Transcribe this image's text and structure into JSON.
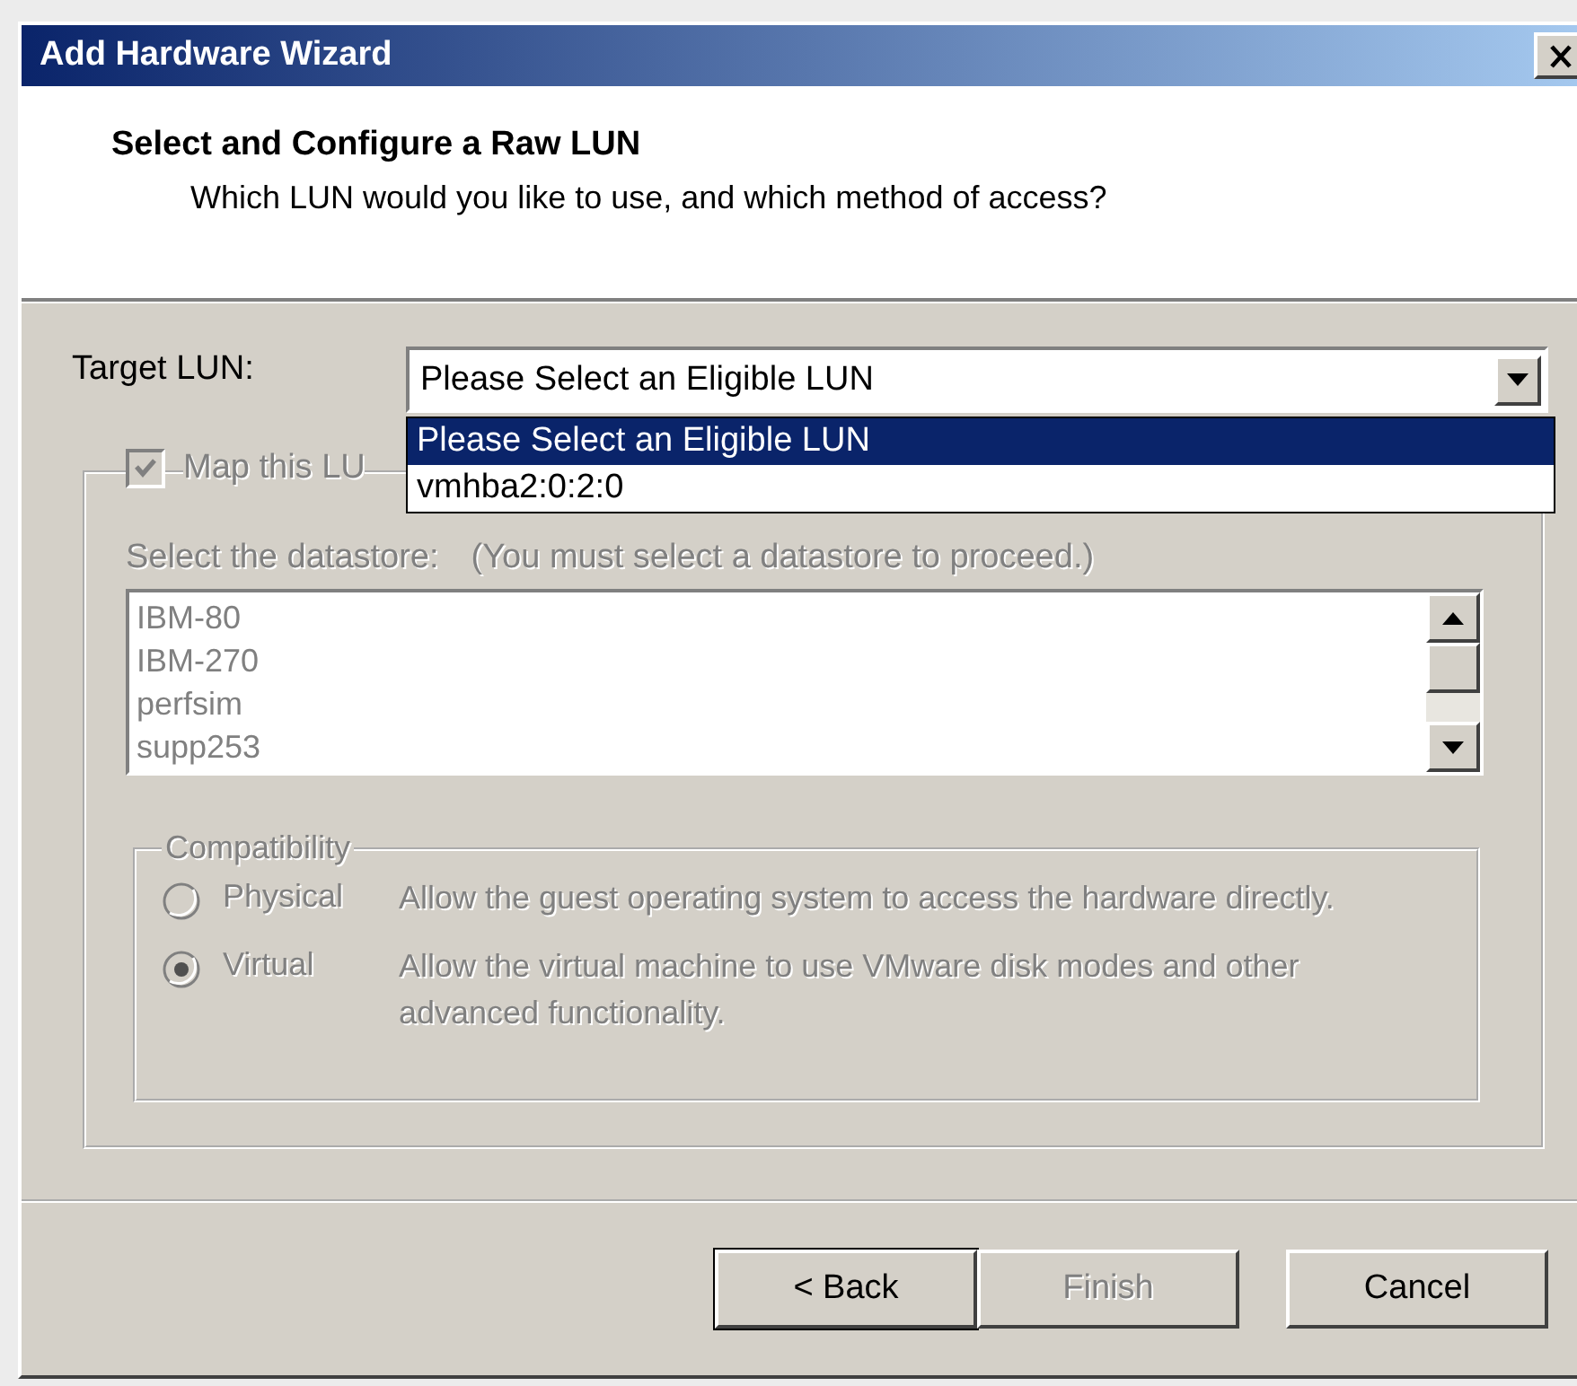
{
  "window": {
    "title": "Add Hardware Wizard"
  },
  "header": {
    "title": "Select and Configure a Raw LUN",
    "subtitle": "Which LUN would you like to use, and which method of access?"
  },
  "target_lun": {
    "label": "Target LUN:",
    "value": "Please Select an Eligible LUN",
    "expanded": true,
    "options": [
      {
        "label": "Please Select an Eligible LUN",
        "selected": true
      },
      {
        "label": "vmhba2:0:2:0",
        "selected": false
      }
    ]
  },
  "map_lun": {
    "label": "Map this LU",
    "checked": true,
    "disabled": true
  },
  "datastore": {
    "label": "Select the datastore:",
    "hint": "(You must select a datastore to proceed.)",
    "disabled": true,
    "items": [
      "IBM-80",
      "IBM-270",
      "perfsim",
      "supp253"
    ]
  },
  "compatibility": {
    "title": "Compatibility",
    "disabled": true,
    "options": [
      {
        "label": "Physical",
        "description": "Allow the guest operating system to access the hardware directly.",
        "selected": false
      },
      {
        "label": "Virtual",
        "description": "Allow the virtual machine to use VMware disk modes and other advanced functionality.",
        "selected": true
      }
    ]
  },
  "buttons": [
    {
      "label": "< Back",
      "disabled": false,
      "default": true
    },
    {
      "label": "Finish",
      "disabled": true,
      "default": false
    },
    {
      "label": "Cancel",
      "disabled": false,
      "default": false
    }
  ]
}
